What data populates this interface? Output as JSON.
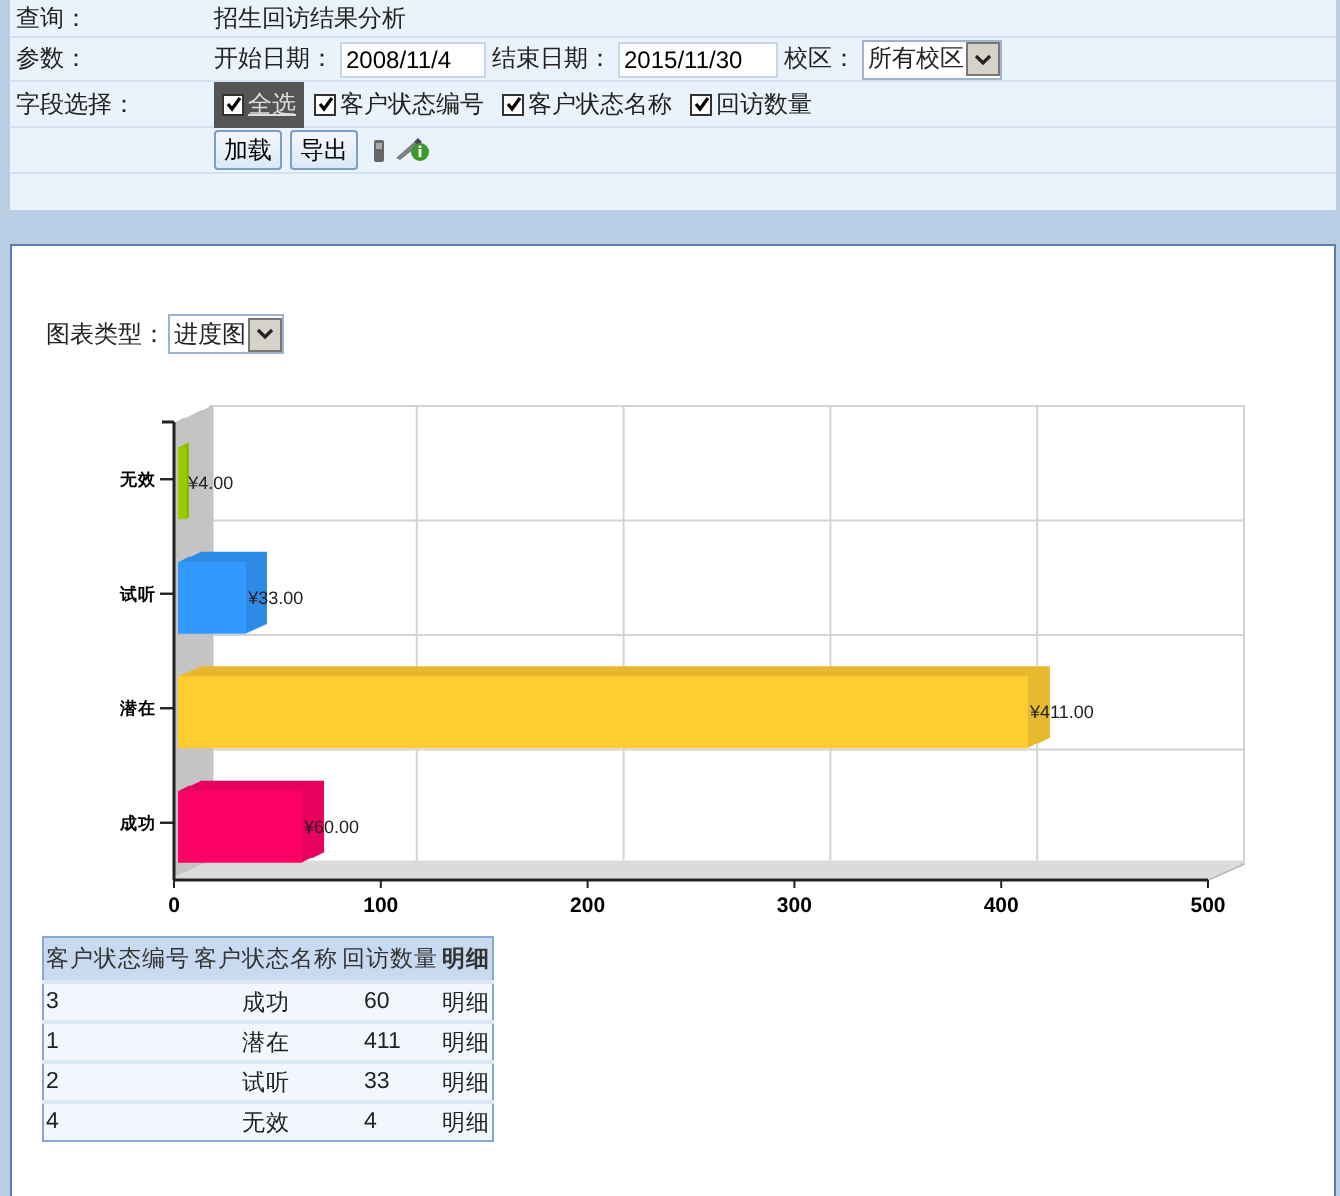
{
  "query": {
    "label": "查询：",
    "value": "招生回访结果分析"
  },
  "params": {
    "label": "参数：",
    "fields": [
      {
        "label": "开始日期：",
        "kind": "text",
        "value": "2008/11/4"
      },
      {
        "label": "结束日期：",
        "kind": "text",
        "value": "2015/11/30"
      },
      {
        "label": "校区：",
        "kind": "select",
        "value": "所有校区"
      }
    ]
  },
  "field_select": {
    "label": "字段选择：",
    "checkboxes": [
      {
        "label": "全选",
        "checked": true,
        "highlighted": true
      },
      {
        "label": "客户状态编号",
        "checked": true,
        "highlighted": false
      },
      {
        "label": "客户状态名称",
        "checked": true,
        "highlighted": false
      },
      {
        "label": "回访数量",
        "checked": true,
        "highlighted": false
      }
    ]
  },
  "buttons": [
    "加载",
    "导出"
  ],
  "chart_panel": {
    "chart_type": {
      "label": "图表类型：",
      "value": "进度图"
    },
    "chart_data": {
      "type": "bar",
      "orientation": "horizontal",
      "categories": [
        "无效",
        "试听",
        "潜在",
        "成功"
      ],
      "series": [
        {
          "values": [
            4,
            33,
            411,
            60
          ],
          "colors": [
            "#99cc00",
            "#3399ff",
            "#ffcc33",
            "#ff0066"
          ]
        }
      ],
      "value_labels": [
        "¥4.00",
        "¥33.00",
        "¥411.00",
        "¥60.00"
      ],
      "xlim": [
        0,
        500
      ],
      "xticks": [
        0,
        100,
        200,
        300,
        400,
        500
      ]
    }
  },
  "table": {
    "columns": [
      "客户状态编号",
      "客户状态名称",
      "回访数量",
      "明细"
    ],
    "rows": [
      [
        "3",
        "成功",
        "60",
        "明细"
      ],
      [
        "1",
        "潜在",
        "411",
        "明细"
      ],
      [
        "2",
        "试听",
        "33",
        "明细"
      ],
      [
        "4",
        "无效",
        "4",
        "明细"
      ]
    ]
  }
}
